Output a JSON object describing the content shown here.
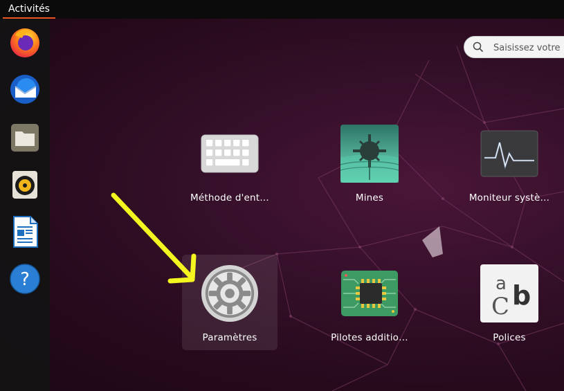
{
  "topbar": {
    "activities_label": "Activités"
  },
  "dock": {
    "items": [
      {
        "name": "firefox",
        "icon": "firefox-icon"
      },
      {
        "name": "thunderbird",
        "icon": "thunderbird-icon"
      },
      {
        "name": "files",
        "icon": "folder-icon"
      },
      {
        "name": "rhythmbox",
        "icon": "speaker-icon"
      },
      {
        "name": "libreoffice-writer",
        "icon": "writer-document-icon"
      },
      {
        "name": "help",
        "icon": "help-icon"
      }
    ]
  },
  "search": {
    "placeholder": "Saisissez votre"
  },
  "apps": [
    {
      "label": "Méthode d'ent…",
      "icon": "keyboard-icon"
    },
    {
      "label": "Mines",
      "icon": "mines-icon"
    },
    {
      "label": "Moniteur systè…",
      "icon": "system-monitor-icon"
    },
    {
      "label": "Paramètres",
      "icon": "gear-icon"
    },
    {
      "label": "Pilotes additio…",
      "icon": "chip-icon"
    },
    {
      "label": "Polices",
      "icon": "fonts-icon"
    }
  ],
  "colors": {
    "accent": "#e95420",
    "arrow": "#f5f520",
    "topbar": "#0b0b0b",
    "background": "#2b0a1e"
  }
}
